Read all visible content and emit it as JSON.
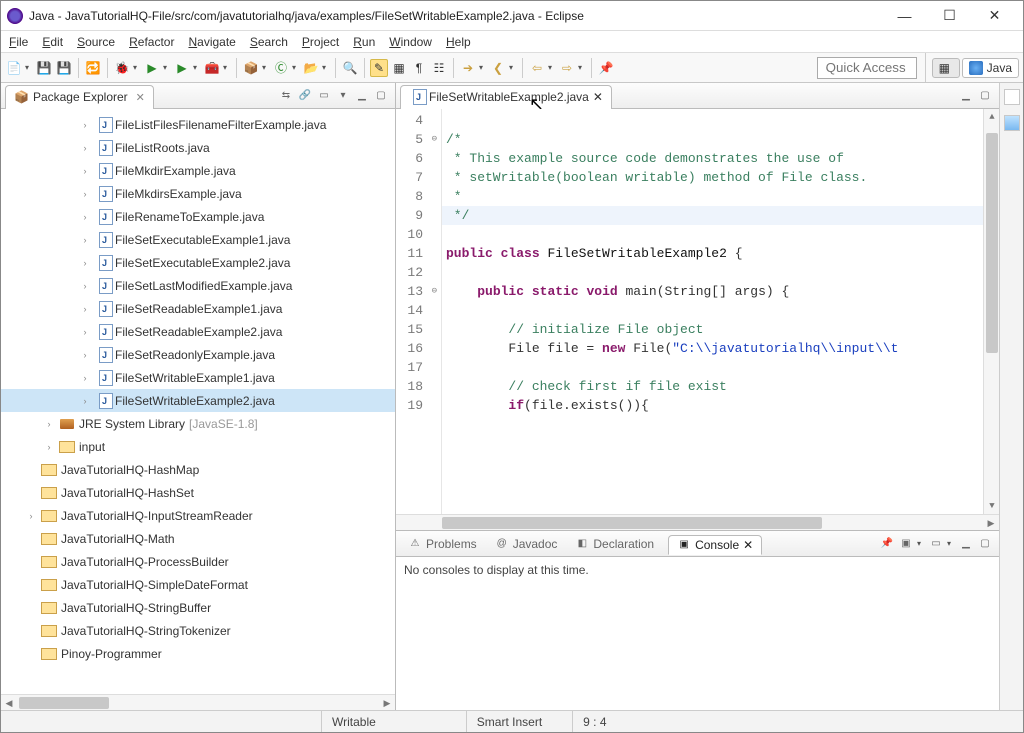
{
  "window": {
    "title": "Java - JavaTutorialHQ-File/src/com/javatutorialhq/java/examples/FileSetWritableExample2.java - Eclipse"
  },
  "menu": [
    "File",
    "Edit",
    "Source",
    "Refactor",
    "Navigate",
    "Search",
    "Project",
    "Run",
    "Window",
    "Help"
  ],
  "quick_access_placeholder": "Quick Access",
  "perspective": {
    "label": "Java"
  },
  "package_explorer": {
    "title": "Package Explorer",
    "java_files": [
      "FileListFilesFilenameFilterExample.java",
      "FileListRoots.java",
      "FileMkdirExample.java",
      "FileMkdirsExample.java",
      "FileRenameToExample.java",
      "FileSetExecutableExample1.java",
      "FileSetExecutableExample2.java",
      "FileSetLastModifiedExample.java",
      "FileSetReadableExample1.java",
      "FileSetReadableExample2.java",
      "FileSetReadonlyExample.java",
      "FileSetWritableExample1.java",
      "FileSetWritableExample2.java"
    ],
    "selected_index": 12,
    "jre": {
      "label": "JRE System Library",
      "hint": "[JavaSE-1.8]"
    },
    "folder_input": "input",
    "projects": [
      "JavaTutorialHQ-HashMap",
      "JavaTutorialHQ-HashSet",
      "JavaTutorialHQ-InputStreamReader",
      "JavaTutorialHQ-Math",
      "JavaTutorialHQ-ProcessBuilder",
      "JavaTutorialHQ-SimpleDateFormat",
      "JavaTutorialHQ-StringBuffer",
      "JavaTutorialHQ-StringTokenizer",
      "Pinoy-Programmer"
    ],
    "project_expandable_index": 2
  },
  "editor": {
    "tab_label": "FileSetWritableExample2.java",
    "first_line_no": 4,
    "lines": [
      {
        "no": 4,
        "raw": ""
      },
      {
        "no": 5,
        "raw": "/*",
        "cls": "cmt",
        "fold": "⊖"
      },
      {
        "no": 6,
        "raw": " * This example source code demonstrates the use of",
        "cls": "cmt"
      },
      {
        "no": 7,
        "raw": " * setWritable(boolean writable) method of File class.",
        "cls": "cmt"
      },
      {
        "no": 8,
        "raw": " *",
        "cls": "cmt"
      },
      {
        "no": 9,
        "raw": " */",
        "cls": "cmt",
        "hl": true
      },
      {
        "no": 10,
        "raw": ""
      },
      {
        "no": 11,
        "html": "<span class='kw'>public</span> <span class='kw'>class</span> <span class='cls'>FileSetWritableExample2</span> {"
      },
      {
        "no": 12,
        "raw": ""
      },
      {
        "no": 13,
        "html": "    <span class='kw'>public</span> <span class='kw'>static</span> <span class='kw'>void</span> main(String[] args) {",
        "fold": "⊖"
      },
      {
        "no": 14,
        "raw": ""
      },
      {
        "no": 15,
        "html": "        <span class='cmt'>// initialize File object</span>"
      },
      {
        "no": 16,
        "html": "        File file = <span class='kw'>new</span> File(<span class='str'>\"C:\\\\javatutorialhq\\\\input\\\\t</span>"
      },
      {
        "no": 17,
        "raw": ""
      },
      {
        "no": 18,
        "html": "        <span class='cmt'>// check first if file exist</span>"
      },
      {
        "no": 19,
        "html": "        <span class='kw'>if</span>(file.exists()){"
      }
    ]
  },
  "bottom": {
    "tabs": [
      {
        "label": "Problems",
        "icon": "⚠"
      },
      {
        "label": "Javadoc",
        "icon": "@"
      },
      {
        "label": "Declaration",
        "icon": "◧"
      },
      {
        "label": "Console",
        "icon": "▣"
      }
    ],
    "active": 3,
    "message": "No consoles to display at this time."
  },
  "status": {
    "writable": "Writable",
    "insert": "Smart Insert",
    "pos": "9 : 4"
  }
}
